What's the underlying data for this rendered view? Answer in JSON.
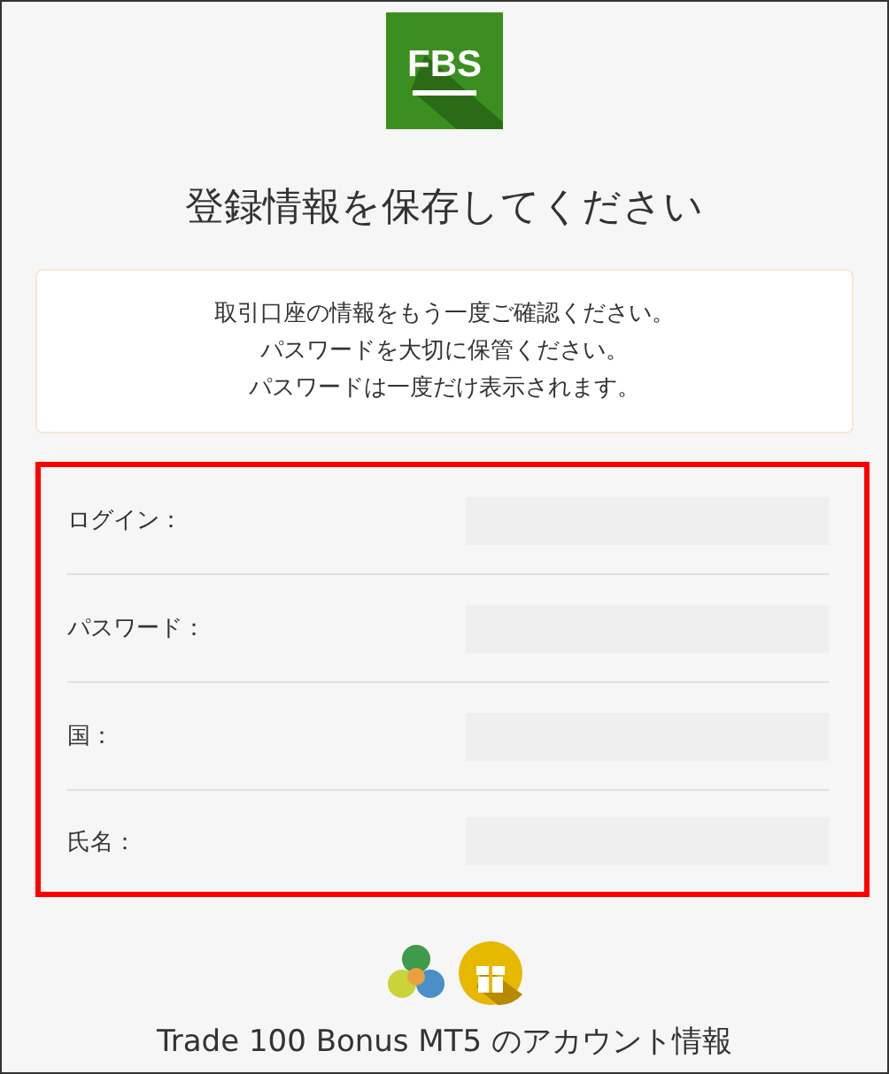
{
  "logo": {
    "text": "FBS"
  },
  "title": "登録情報を保存してください",
  "notice": [
    "取引口座の情報をもう一度ご確認ください。",
    "パスワードを大切に保管ください。",
    "パスワードは一度だけ表示されます。"
  ],
  "fields": [
    {
      "label": "ログイン："
    },
    {
      "label": "パスワード："
    },
    {
      "label": "国："
    },
    {
      "label": "氏名："
    }
  ],
  "footer": {
    "account": "Trade 100 Bonus MT5 のアカウント情報"
  }
}
